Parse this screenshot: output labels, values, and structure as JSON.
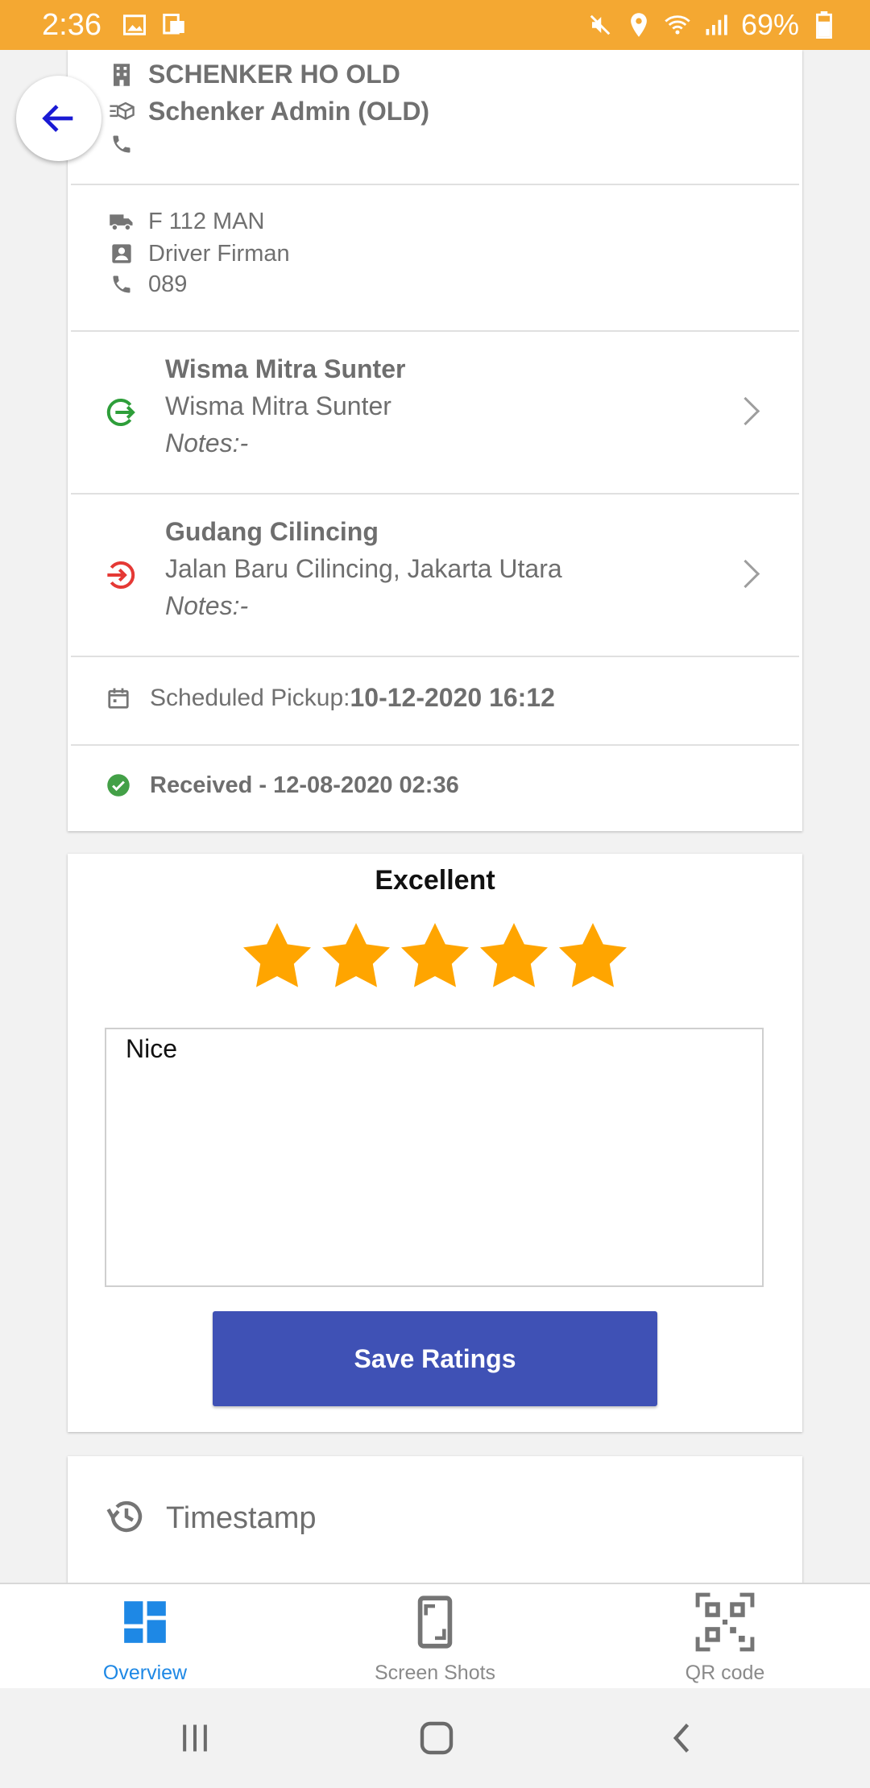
{
  "status_bar": {
    "time": "2:36",
    "battery": "69%",
    "icons_left": [
      "image-icon",
      "cast-icon"
    ],
    "icons_right": [
      "mute-icon",
      "location-icon",
      "wifi-icon",
      "signal-icon",
      "battery-icon"
    ]
  },
  "company": {
    "name": "SCHENKER HO OLD",
    "admin": "Schenker Admin (OLD)",
    "phone": ""
  },
  "vehicle": {
    "plate": "F 112 MAN",
    "driver": "Driver Firman",
    "phone": "089"
  },
  "origin": {
    "title": "Wisma Mitra Sunter",
    "address": "Wisma Mitra Sunter",
    "notes": "Notes:-"
  },
  "destination": {
    "title": "Gudang Cilincing",
    "address": "Jalan Baru Cilincing, Jakarta Utara",
    "notes": "Notes:-"
  },
  "schedule": {
    "label": "Scheduled Pickup:",
    "value": "10-12-2020 16:12"
  },
  "status": {
    "text": "Received - 12-08-2020 02:36"
  },
  "rating": {
    "label": "Excellent",
    "stars_filled": 5,
    "stars_total": 5,
    "comment": "Nice",
    "save_label": "Save Ratings"
  },
  "timestamp": {
    "label": "Timestamp"
  },
  "bottom_nav": {
    "overview": "Overview",
    "screenshots": "Screen Shots",
    "qrcode": "QR code",
    "active": "Overview"
  },
  "colors": {
    "status_bar": "#f4a832",
    "accent": "#1e88e5",
    "button": "#3f51b5",
    "star": "#ffa500",
    "origin_icon": "#2e9e3a",
    "destination_icon": "#e53935",
    "received_icon": "#43a047"
  }
}
